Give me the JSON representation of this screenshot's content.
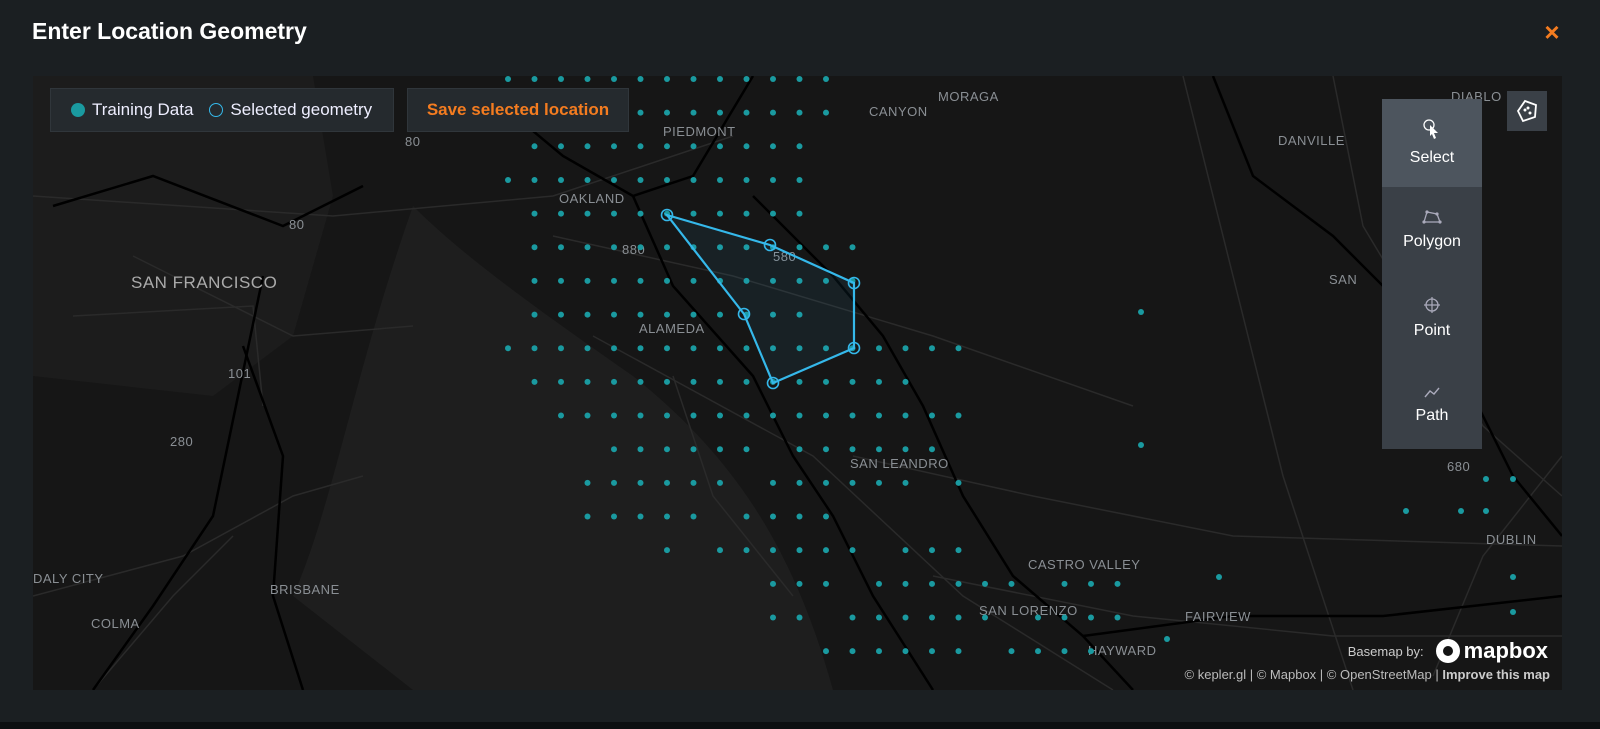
{
  "modal": {
    "title": "Enter Location Geometry",
    "close_icon": "×"
  },
  "legend": {
    "training_label": "Training Data",
    "selected_label": "Selected geometry"
  },
  "toolbar": {
    "save_label": "Save selected location"
  },
  "draw_tools": [
    {
      "label": "Select",
      "icon": "cursor-icon",
      "active": true
    },
    {
      "label": "Polygon",
      "icon": "polygon-icon",
      "active": false
    },
    {
      "label": "Point",
      "icon": "crosshair-icon",
      "active": false
    },
    {
      "label": "Path",
      "icon": "path-icon",
      "active": false
    }
  ],
  "map_labels": [
    {
      "text": "MORAGA"
    },
    {
      "text": "CANYON"
    },
    {
      "text": "PIEDMONT"
    },
    {
      "text": "DANVILLE"
    },
    {
      "text": "DIABLO"
    },
    {
      "text": "OAKLAND"
    },
    {
      "text": "SAN FRANCISCO"
    },
    {
      "text": "ALAMEDA"
    },
    {
      "text": "SAN LEANDRO"
    },
    {
      "text": "CASTRO VALLEY"
    },
    {
      "text": "SAN LORENZO"
    },
    {
      "text": "FAIRVIEW"
    },
    {
      "text": "DUBLIN"
    },
    {
      "text": "DALY CITY"
    },
    {
      "text": "BRISBANE"
    },
    {
      "text": "COLMA"
    },
    {
      "text": "HAYWARD"
    },
    {
      "text": "SAN"
    },
    {
      "text": "80"
    },
    {
      "text": "80"
    },
    {
      "text": "880"
    },
    {
      "text": "580"
    },
    {
      "text": "101"
    },
    {
      "text": "280"
    },
    {
      "text": "680"
    }
  ],
  "attribution": {
    "basemap_by": "Basemap by:",
    "mapbox": "mapbox",
    "credits": "© kepler.gl | © Mapbox | © OpenStreetMap | ",
    "improve": "Improve this map"
  },
  "colors": {
    "accent": "#f47c20",
    "training": "#1a9aa0",
    "selection": "#35b8ea",
    "panel": "#3a4047"
  }
}
